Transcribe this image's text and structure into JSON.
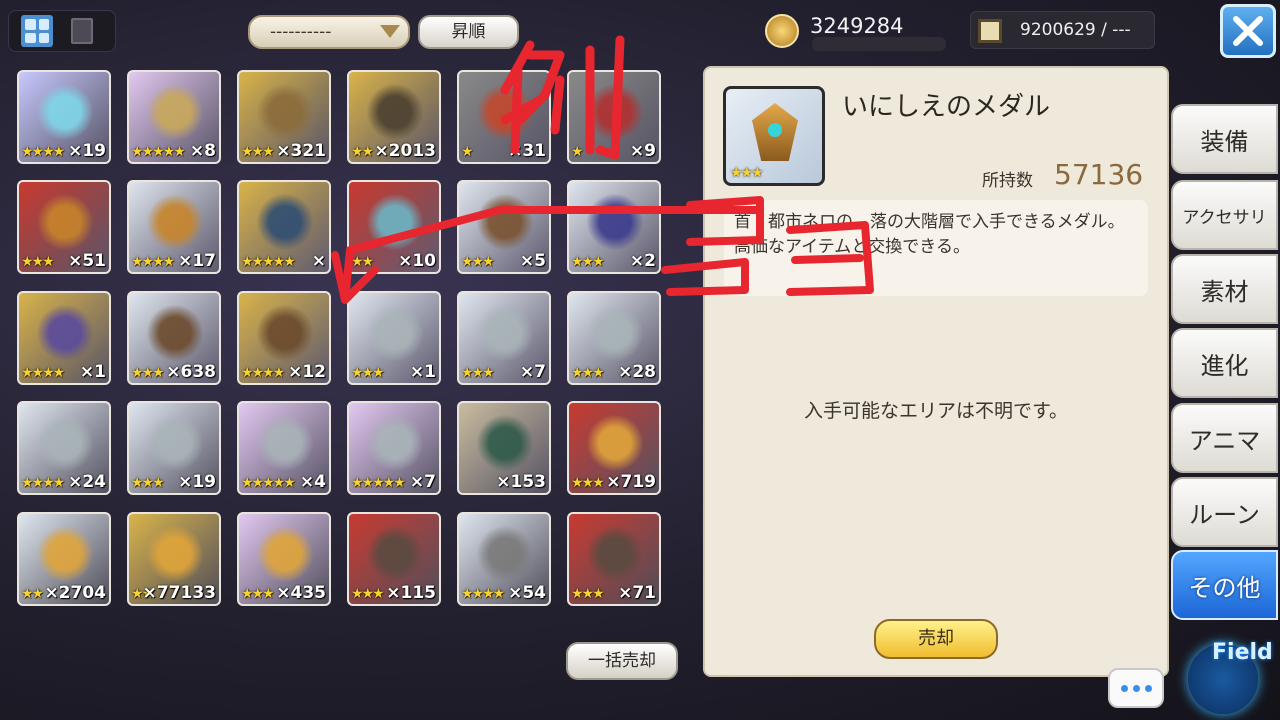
{
  "toolbar": {
    "view_grid_icon": "grid-view-icon",
    "view_list_icon": "list-view-icon",
    "filter_value": "----------",
    "sort_label": "昇順",
    "coins": "3249284",
    "resource": "9200629 / ---",
    "close_icon": "close-icon"
  },
  "items": [
    {
      "stars": "★★★★",
      "qty": "×19",
      "bg": "#c8c8ff",
      "art": "#7fd6e8"
    },
    {
      "stars": "★★★★★",
      "qty": "×8",
      "bg": "#e2c8f0",
      "art": "#c9a85a"
    },
    {
      "stars": "★★★",
      "qty": "×321",
      "bg": "#d9b34a",
      "art": "#8b6b3a"
    },
    {
      "stars": "★★",
      "qty": "×2013",
      "bg": "#d9b34a",
      "art": "#4b4030"
    },
    {
      "stars": "★",
      "qty": "×31",
      "bg": "#8a8a8a",
      "art": "#c4472c"
    },
    {
      "stars": "★",
      "qty": "×9",
      "bg": "#8a8a8a",
      "art": "#b13030"
    },
    {
      "stars": "★★★",
      "qty": "×51",
      "bg": "#c83a30",
      "art": "#c7842a"
    },
    {
      "stars": "★★★★",
      "qty": "×17",
      "bg": "#dfe6ee",
      "art": "#c7842a"
    },
    {
      "stars": "★★★★★",
      "qty": "×",
      "bg": "#d9b34a",
      "art": "#2f4d73"
    },
    {
      "stars": "★★",
      "qty": "×10",
      "bg": "#c83a30",
      "art": "#6bb5c4"
    },
    {
      "stars": "★★★",
      "qty": "×5",
      "bg": "#dfe6ee",
      "art": "#7a5230"
    },
    {
      "stars": "★★★",
      "qty": "×2",
      "bg": "#dfe6ee",
      "art": "#3a3a8c"
    },
    {
      "stars": "★★★★",
      "qty": "×1",
      "bg": "#d9b34a",
      "art": "#5a4a9c"
    },
    {
      "stars": "★★★",
      "qty": "×638",
      "bg": "#dfe6ee",
      "art": "#6b4a2c"
    },
    {
      "stars": "★★★★",
      "qty": "×12",
      "bg": "#d9b34a",
      "art": "#6b4a2c"
    },
    {
      "stars": "★★★",
      "qty": "×1",
      "bg": "#dfe6ee",
      "art": "#a9b4b8"
    },
    {
      "stars": "★★★",
      "qty": "×7",
      "bg": "#dfe6ee",
      "art": "#a9b4b8"
    },
    {
      "stars": "★★★",
      "qty": "×28",
      "bg": "#dfe6ee",
      "art": "#a9b4b8"
    },
    {
      "stars": "★★★★",
      "qty": "×24",
      "bg": "#dfe6ee",
      "art": "#a9b4b8"
    },
    {
      "stars": "★★★",
      "qty": "×19",
      "bg": "#dfe6ee",
      "art": "#a9b4b8"
    },
    {
      "stars": "★★★★★",
      "qty": "×4",
      "bg": "#e2c8f0",
      "art": "#a9b4b8"
    },
    {
      "stars": "★★★★★",
      "qty": "×7",
      "bg": "#e2c8f0",
      "art": "#a9b4b8"
    },
    {
      "stars": "",
      "qty": "×153",
      "bg": "#c9bc9e",
      "art": "#2f5a4a"
    },
    {
      "stars": "★★★",
      "qty": "×719",
      "bg": "#c83a30",
      "art": "#e0a53a"
    },
    {
      "stars": "★★",
      "qty": "×2704",
      "bg": "#dfe6ee",
      "art": "#e0a53a"
    },
    {
      "stars": "★★",
      "qty": "×77133",
      "bg": "#d9b34a",
      "art": "#e0a53a"
    },
    {
      "stars": "★★★",
      "qty": "×435",
      "bg": "#e2c8f0",
      "art": "#e0a53a"
    },
    {
      "stars": "★★★",
      "qty": "×115",
      "bg": "#c83a30",
      "art": "#5a4a40"
    },
    {
      "stars": "★★★★",
      "qty": "×54",
      "bg": "#dfe6ee",
      "art": "#7a7a7a"
    },
    {
      "stars": "★★★",
      "qty": "×71",
      "bg": "#c83a30",
      "art": "#5a4a40"
    }
  ],
  "detail": {
    "name": "いにしえのメダル",
    "stars": "★★★",
    "owned_label": "所持数",
    "owned_value": "57136",
    "description": "首　都市ネロの　落の大階層で入手できるメダル。高価なアイテムと交換できる。",
    "area_text": "入手可能なエリアは不明です。",
    "sell_label": "売却"
  },
  "bulk_sell_label": "一括売却",
  "tabs": [
    {
      "label": "装備",
      "active": false
    },
    {
      "label": "アクセサリ",
      "active": false
    },
    {
      "label": "素材",
      "active": false
    },
    {
      "label": "進化",
      "active": false
    },
    {
      "label": "アニマ",
      "active": false
    },
    {
      "label": "ルーン",
      "active": false
    },
    {
      "label": "その他",
      "active": true
    }
  ],
  "field_label": "Field",
  "chat_icon": "chat-bubble-icon",
  "annotation": {
    "text1": "例",
    "text2": "ココ",
    "color": "#e8262f"
  }
}
